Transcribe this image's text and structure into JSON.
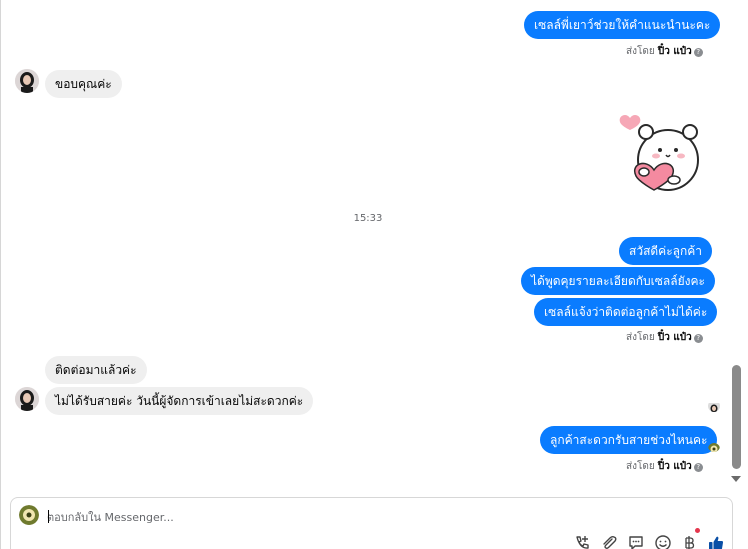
{
  "messages": {
    "out_top": "เซลล์พี่เยาว์ช่วยให้คำแนะนำนะคะ",
    "in_thanks": "ขอบคุณค่ะ",
    "out_hello": "สวัสดีค่ะลูกค้า",
    "out_talk": "ได้พูดคุยรายละเอียดกับเซลล์ยังคะ",
    "out_sales": "เซลล์แจ้งว่าติดต่อลูกค้าไม่ได้ค่ะ",
    "in_contacted": "ติดต่อมาแล้วค่ะ",
    "in_missed": "ไม่ได้รับสายค่ะ วันนี้ผู้จัดการเข้าเลยไม่สะดวกค่ะ",
    "out_when": "ลูกค้าสะดวกรับสายช่วงไหนคะ"
  },
  "sent_by": {
    "prefix": "ส่งโดย",
    "name": "ปิ๋ว แป๋ว",
    "help": "?"
  },
  "timestamp": "15:33",
  "sticker": {
    "name": "bear-hugging-heart-sticker"
  },
  "composer": {
    "placeholder": "ตอบกลับใน Messenger..."
  },
  "colors": {
    "outgoing_bubble": "#0a7cff",
    "incoming_bubble": "#efefef",
    "like_icon": "#0a4fa6",
    "notification_dot": "#e4364d"
  },
  "icons": {
    "toolbar": [
      "call-add-icon",
      "attachment-icon",
      "chat-template-icon",
      "emoji-icon",
      "baht-payment-icon",
      "like-icon"
    ]
  }
}
